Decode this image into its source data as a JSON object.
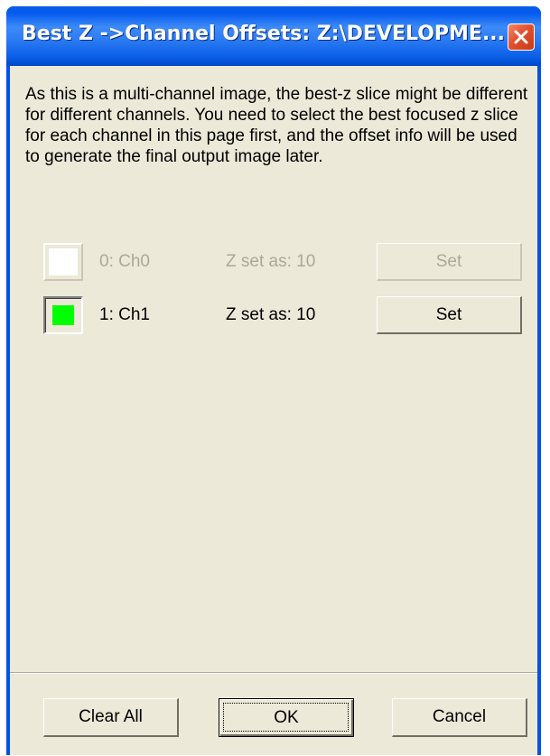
{
  "window": {
    "title": "Best Z ->Channel Offsets: Z:\\DEVELOPME...",
    "close_icon": "close-icon"
  },
  "intro": {
    "text": "As this is a multi-channel image, the best-z slice might be different for different channels.  You need to select the best focused z slice for each channel in this page first, and the offset info will be used to generate the final output image later."
  },
  "channels": [
    {
      "label": "0: Ch0",
      "z_text": "Z set as: 10",
      "set_label": "Set",
      "color": "#ffffff",
      "enabled": false
    },
    {
      "label": "1: Ch1",
      "z_text": "Z set as: 10",
      "set_label": "Set",
      "color": "#00ff00",
      "enabled": true
    }
  ],
  "footer": {
    "clear_all_label": "Clear All",
    "ok_label": "OK",
    "cancel_label": "Cancel"
  },
  "colors": {
    "titlebar": "#0054e3",
    "dialog_bg": "#ece9d8",
    "disabled_text": "#aca899",
    "close_red": "#e2502f"
  }
}
